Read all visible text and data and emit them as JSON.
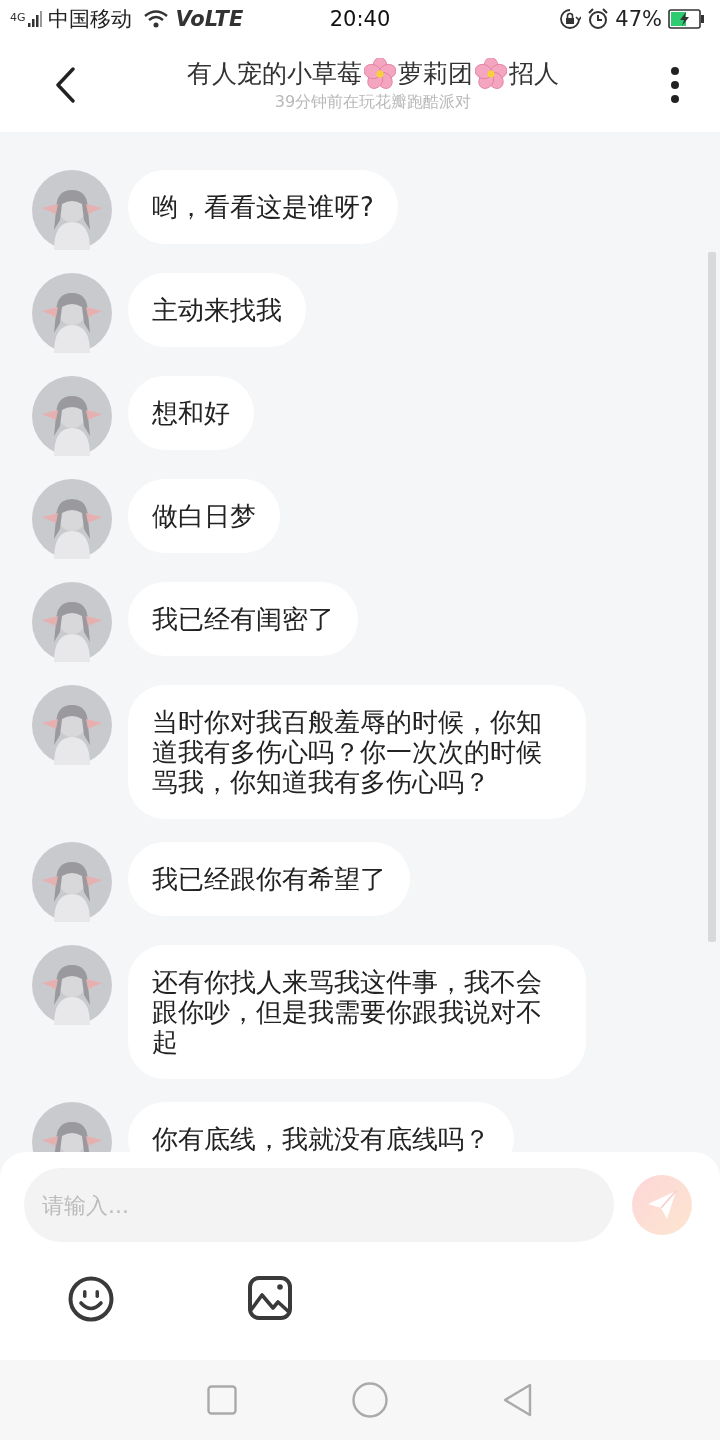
{
  "status_bar": {
    "network_type": "4G",
    "carrier": "中国移动",
    "volte": "VoLTE",
    "time": "20:40",
    "battery_percent": "47%"
  },
  "header": {
    "title": [
      {
        "kind": "text",
        "text": "有人宠的小草莓"
      },
      {
        "kind": "flower"
      },
      {
        "kind": "text",
        "text": "萝莉团"
      },
      {
        "kind": "flower"
      },
      {
        "kind": "text",
        "text": "招人"
      }
    ],
    "subtitle": "39分钟前在玩花瓣跑酷派对"
  },
  "messages": [
    {
      "text": "哟，看看这是谁呀?"
    },
    {
      "text": "主动来找我"
    },
    {
      "text": "想和好"
    },
    {
      "text": "做白日梦"
    },
    {
      "text": "我已经有闺密了"
    },
    {
      "text": "当时你对我百般羞辱的时候，你知道我有多伤心吗？你一次次的时候骂我，你知道我有多伤心吗？"
    },
    {
      "text": "我已经跟你有希望了"
    },
    {
      "text": "还有你找人来骂我这件事，我不会跟你吵，但是我需要你跟我说对不起"
    },
    {
      "text": "你有底线，我就没有底线吗？"
    }
  ],
  "composer": {
    "placeholder": "请输入..."
  }
}
